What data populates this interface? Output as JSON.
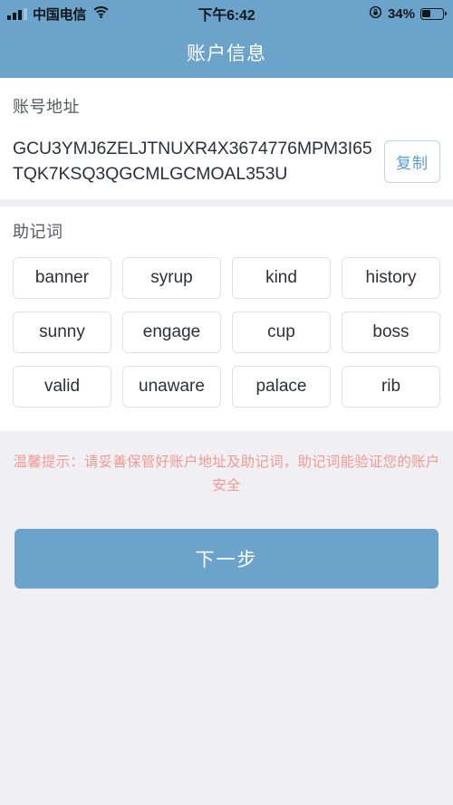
{
  "status_bar": {
    "carrier": "中国电信",
    "time": "下午6:42",
    "battery_percent": "34%",
    "battery_level": 34,
    "signal_bars_filled": 3,
    "signal_bars_total": 4,
    "icons": [
      "signal-bars-icon",
      "wifi-icon",
      "rotation-lock-icon",
      "battery-icon"
    ]
  },
  "nav": {
    "title": "账户信息"
  },
  "address_section": {
    "label": "账号地址",
    "address": "GCU3YMJ6ZELJTNUXR4X3674776MPM3I65TQK7KSQ3QGCMLGCMOAL353U",
    "copy_label": "复制"
  },
  "mnemonic_section": {
    "label": "助记词",
    "words": [
      "banner",
      "syrup",
      "kind",
      "history",
      "sunny",
      "engage",
      "cup",
      "boss",
      "valid",
      "unaware",
      "palace",
      "rib"
    ]
  },
  "tip": {
    "text": "温馨提示：请妥善保管好账户地址及助记词，助记词能验证您的账户安全",
    "color": "#f09a92"
  },
  "footer": {
    "next_label": "下一步"
  },
  "colors": {
    "accent": "#6BA3CA",
    "page_background": "#EFEFF4",
    "card_background": "#FFFFFF",
    "copy_border": "#B9D4E6",
    "chip_border": "#E0E1E4",
    "warning": "#F09A92"
  }
}
